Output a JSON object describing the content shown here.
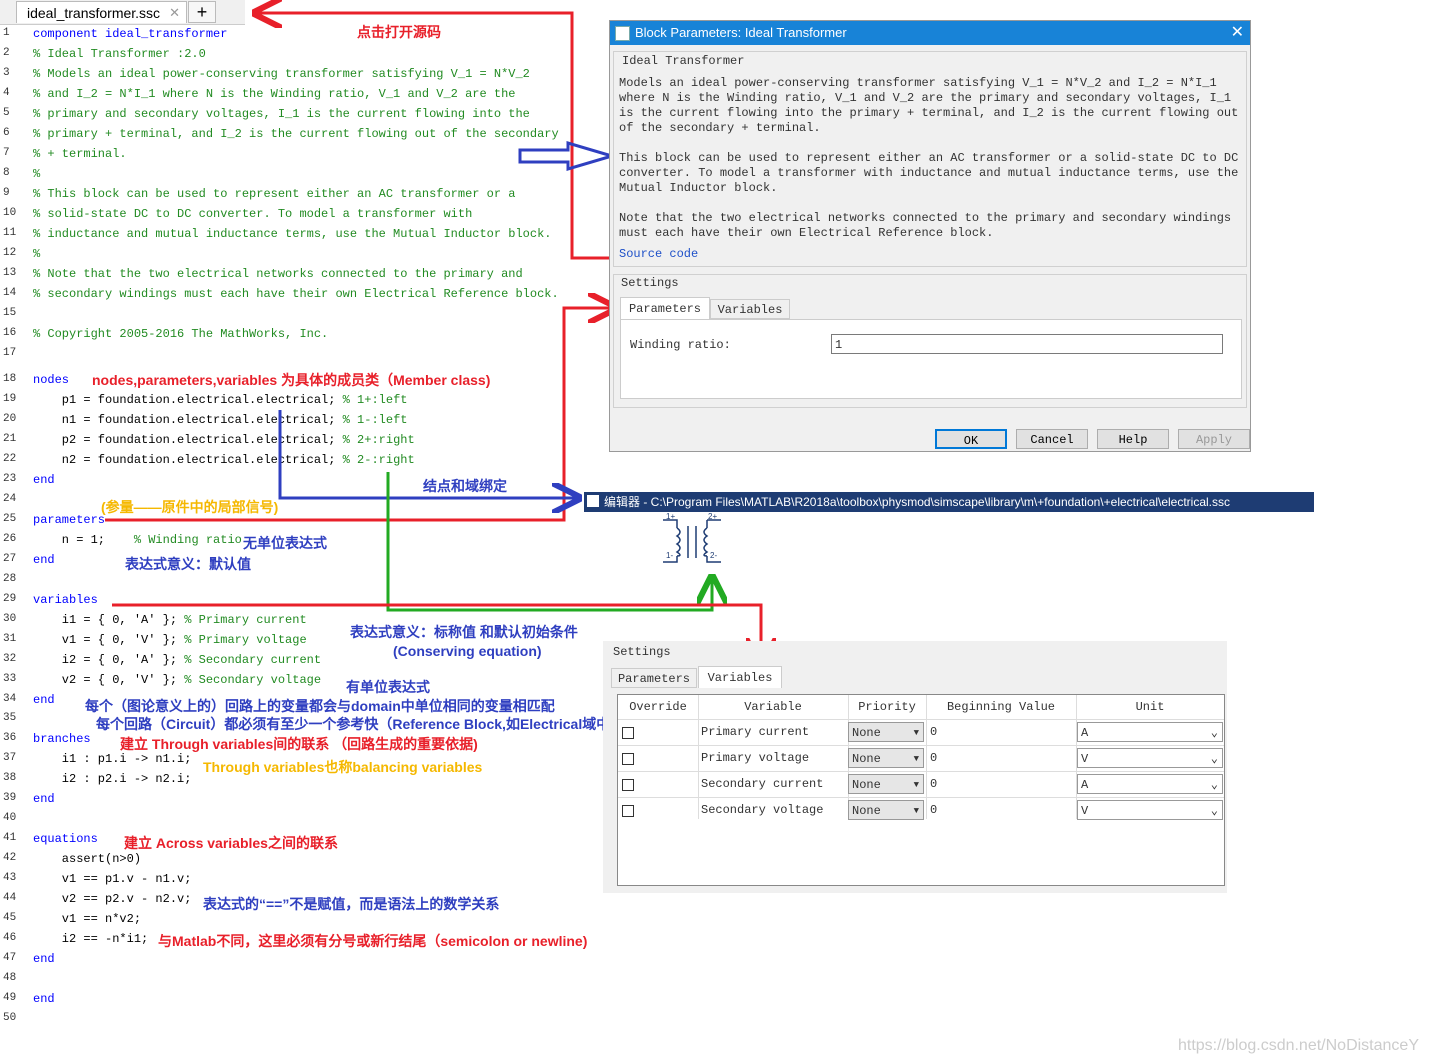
{
  "editor": {
    "tab_label": "ideal_transformer.ssc",
    "tab_close": "✕",
    "tab_add": "+"
  },
  "code_lines": [
    {
      "n": "1",
      "t": "component ideal_transformer",
      "k": "kw"
    },
    {
      "n": "2",
      "t": "% Ideal Transformer :2.0",
      "k": "cm"
    },
    {
      "n": "3",
      "t": "% Models an ideal power-conserving transformer satisfying V_1 = N*V_2",
      "k": "cm"
    },
    {
      "n": "4",
      "t": "% and I_2 = N*I_1 where N is the Winding ratio, V_1 and V_2 are the",
      "k": "cm"
    },
    {
      "n": "5",
      "t": "% primary and secondary voltages, I_1 is the current flowing into the",
      "k": "cm"
    },
    {
      "n": "6",
      "t": "% primary + terminal, and I_2 is the current flowing out of the secondary",
      "k": "cm"
    },
    {
      "n": "7",
      "t": "% + terminal.",
      "k": "cm"
    },
    {
      "n": "8",
      "t": "%",
      "k": "cm"
    },
    {
      "n": "9",
      "t": "% This block can be used to represent either an AC transformer or a",
      "k": "cm"
    },
    {
      "n": "10",
      "t": "% solid-state DC to DC converter. To model a transformer with",
      "k": "cm"
    },
    {
      "n": "11",
      "t": "% inductance and mutual inductance terms, use the Mutual Inductor block.",
      "k": "cm"
    },
    {
      "n": "12",
      "t": "%",
      "k": "cm"
    },
    {
      "n": "13",
      "t": "% Note that the two electrical networks connected to the primary and",
      "k": "cm"
    },
    {
      "n": "14",
      "t": "% secondary windings must each have their own Electrical Reference block.",
      "k": "cm"
    },
    {
      "n": "15",
      "t": "",
      "k": ""
    },
    {
      "n": "16",
      "t": "% Copyright 2005-2016 The MathWorks, Inc.",
      "k": "cm"
    },
    {
      "n": "17",
      "t": "",
      "k": ""
    },
    {
      "n": "18",
      "t": "nodes",
      "k": "kw"
    },
    {
      "n": "19",
      "t": "    p1 = foundation.electrical.electrical; ",
      "k": "",
      "c": "% 1+:left"
    },
    {
      "n": "20",
      "t": "    n1 = foundation.electrical.electrical; ",
      "k": "",
      "c": "% 1-:left"
    },
    {
      "n": "21",
      "t": "    p2 = foundation.electrical.electrical; ",
      "k": "",
      "c": "% 2+:right"
    },
    {
      "n": "22",
      "t": "    n2 = foundation.electrical.electrical; ",
      "k": "",
      "c": "% 2-:right"
    },
    {
      "n": "23",
      "t": "end",
      "k": "kw"
    },
    {
      "n": "24",
      "t": "",
      "k": ""
    },
    {
      "n": "25",
      "t": "parameters",
      "k": "kw"
    },
    {
      "n": "26",
      "t": "    n = 1;    ",
      "k": "",
      "c": "% Winding ratio"
    },
    {
      "n": "27",
      "t": "end",
      "k": "kw"
    },
    {
      "n": "28",
      "t": "",
      "k": ""
    },
    {
      "n": "29",
      "t": "variables",
      "k": "kw"
    },
    {
      "n": "30",
      "t": "    i1 = { 0, 'A' }; ",
      "k": "",
      "c": "% Primary current"
    },
    {
      "n": "31",
      "t": "    v1 = { 0, 'V' }; ",
      "k": "",
      "c": "% Primary voltage"
    },
    {
      "n": "32",
      "t": "    i2 = { 0, 'A' }; ",
      "k": "",
      "c": "% Secondary current"
    },
    {
      "n": "33",
      "t": "    v2 = { 0, 'V' }; ",
      "k": "",
      "c": "% Secondary voltage"
    },
    {
      "n": "34",
      "t": "end",
      "k": "kw"
    },
    {
      "n": "35",
      "t": "",
      "k": ""
    },
    {
      "n": "36",
      "t": "branches",
      "k": "kw"
    },
    {
      "n": "37",
      "t": "    i1 : p1.i -> n1.i;",
      "k": ""
    },
    {
      "n": "38",
      "t": "    i2 : p2.i -> n2.i;",
      "k": ""
    },
    {
      "n": "39",
      "t": "end",
      "k": "kw"
    },
    {
      "n": "40",
      "t": "",
      "k": ""
    },
    {
      "n": "41",
      "t": "equations",
      "k": "kw"
    },
    {
      "n": "42",
      "t": "    assert(n>0)",
      "k": ""
    },
    {
      "n": "43",
      "t": "    v1 == p1.v - n1.v;",
      "k": ""
    },
    {
      "n": "44",
      "t": "    v2 == p2.v - n2.v;",
      "k": ""
    },
    {
      "n": "45",
      "t": "    v1 == n*v2;",
      "k": ""
    },
    {
      "n": "46",
      "t": "    i2 == -n*i1;",
      "k": ""
    },
    {
      "n": "47",
      "t": "end",
      "k": "kw"
    },
    {
      "n": "48",
      "t": "",
      "k": ""
    },
    {
      "n": "49",
      "t": "end",
      "k": "kw"
    },
    {
      "n": "50",
      "t": "",
      "k": ""
    }
  ],
  "annotations": {
    "open_source": "点击打开源码",
    "member_class": "nodes,parameters,variables 为具体的成员类（Member class)",
    "node_domain": "结点和域绑定",
    "param_local": "(参量——原件中的局部信号)",
    "unitless": "无单位表达式",
    "default_val": "表达式意义：默认值",
    "nominal": "表达式意义：标称值 和默认初始条件",
    "conserving": "(Conserving equation)",
    "with_unit": "有单位表达式",
    "circuit_1": "每个（图论意义上的）回路上的变量都会与domain中单位相同的变量相匹配",
    "circuit_2": "每个回路（Circuit）都必须有至少一个参考快（Reference Block,如Electrical域中的参考地）",
    "through_1": "建立 Through   variables间的联系 （回路生成的重要依据)",
    "through_2": "Through variables也称balancing variables",
    "across": "建立 Across variables之间的联系",
    "eqeq": "表达式的“==”不是赋值，而是语法上的数学关系",
    "semicolon": "与Matlab不同，这里必须有分号或新行结尾（semicolon or newline)"
  },
  "dialog": {
    "title": "Block Parameters: Ideal Transformer",
    "close": "✕",
    "block_name": "Ideal Transformer",
    "desc_1": "Models an ideal power-conserving transformer satisfying V_1 = N*V_2 and I_2 = N*I_1 where N is the Winding ratio, V_1 and V_2 are the primary and secondary voltages, I_1 is the current flowing into the primary + terminal, and I_2 is the current flowing out of the secondary + terminal.",
    "desc_2": "This block can be used to represent either an AC transformer or a solid-state DC to DC converter. To model a transformer with inductance and mutual inductance terms, use the Mutual Inductor block.",
    "desc_3": "Note that the two electrical networks connected to the primary and secondary windings must each have their own Electrical Reference block.",
    "source_link": "Source code",
    "settings_label": "Settings",
    "tab_parameters": "Parameters",
    "tab_variables": "Variables",
    "winding_label": "Winding ratio:",
    "winding_value": "1",
    "btn_ok": "OK",
    "btn_cancel": "Cancel",
    "btn_help": "Help",
    "btn_apply": "Apply"
  },
  "matlab_bar": {
    "label": "编辑器 - C:\\Program Files\\MATLAB\\R2018a\\toolbox\\physmod\\simscape\\library\\m\\+foundation\\+electrical\\electrical.ssc"
  },
  "symbol": {
    "p1": "1+",
    "p2": "2+",
    "n1": "1-",
    "n2": "2-"
  },
  "variables_panel": {
    "settings_label": "Settings",
    "tab_parameters": "Parameters",
    "tab_variables": "Variables",
    "headers": [
      "Override",
      "Variable",
      "Priority",
      "Beginning Value",
      "Unit"
    ],
    "rows": [
      {
        "variable": "Primary current",
        "priority": "None",
        "value": "0",
        "unit": "A"
      },
      {
        "variable": "Primary voltage",
        "priority": "None",
        "value": "0",
        "unit": "V"
      },
      {
        "variable": "Secondary current",
        "priority": "None",
        "value": "0",
        "unit": "A"
      },
      {
        "variable": "Secondary voltage",
        "priority": "None",
        "value": "0",
        "unit": "V"
      }
    ]
  },
  "watermark": "https://blog.csdn.net/NoDistanceY",
  "colors": {
    "arrow_red": "#e8202a",
    "arrow_blue": "#2f3fc0",
    "arrow_green": "#22aa22",
    "title_blue": "#1883d7"
  }
}
